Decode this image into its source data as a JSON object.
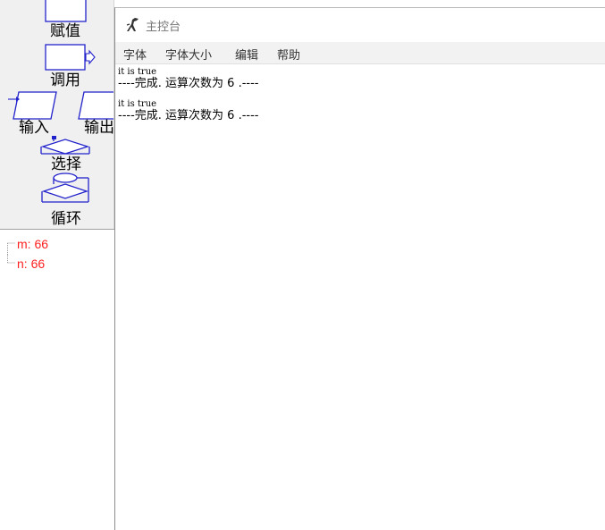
{
  "palette": {
    "items": [
      {
        "label": "赋值",
        "icon": "assign-block-icon"
      },
      {
        "label": "调用",
        "icon": "call-block-icon"
      },
      {
        "label": "输入",
        "icon": "input-block-icon"
      },
      {
        "label": "输出",
        "icon": "output-block-icon"
      },
      {
        "label": "选择",
        "icon": "selection-block-icon"
      },
      {
        "label": "循环",
        "icon": "loop-block-icon"
      }
    ],
    "shape_color": "#2222cc"
  },
  "variables": {
    "items": [
      {
        "text": "m: 66"
      },
      {
        "text": "n: 66"
      }
    ],
    "color": "#ff2020"
  },
  "console": {
    "title": "主控台",
    "icon": "dinosaur-icon",
    "menu": [
      {
        "label": "字体"
      },
      {
        "label": "字体大小"
      },
      {
        "label": "编辑"
      },
      {
        "label": "帮助"
      }
    ],
    "lines": [
      {
        "text": "it is true",
        "style": "small"
      },
      {
        "text": "----完成. 运算次数为 6 .----",
        "style": "big"
      },
      {
        "text": "it is true",
        "style": "small"
      },
      {
        "text": "----完成. 运算次数为 6 .----",
        "style": "big"
      }
    ]
  }
}
